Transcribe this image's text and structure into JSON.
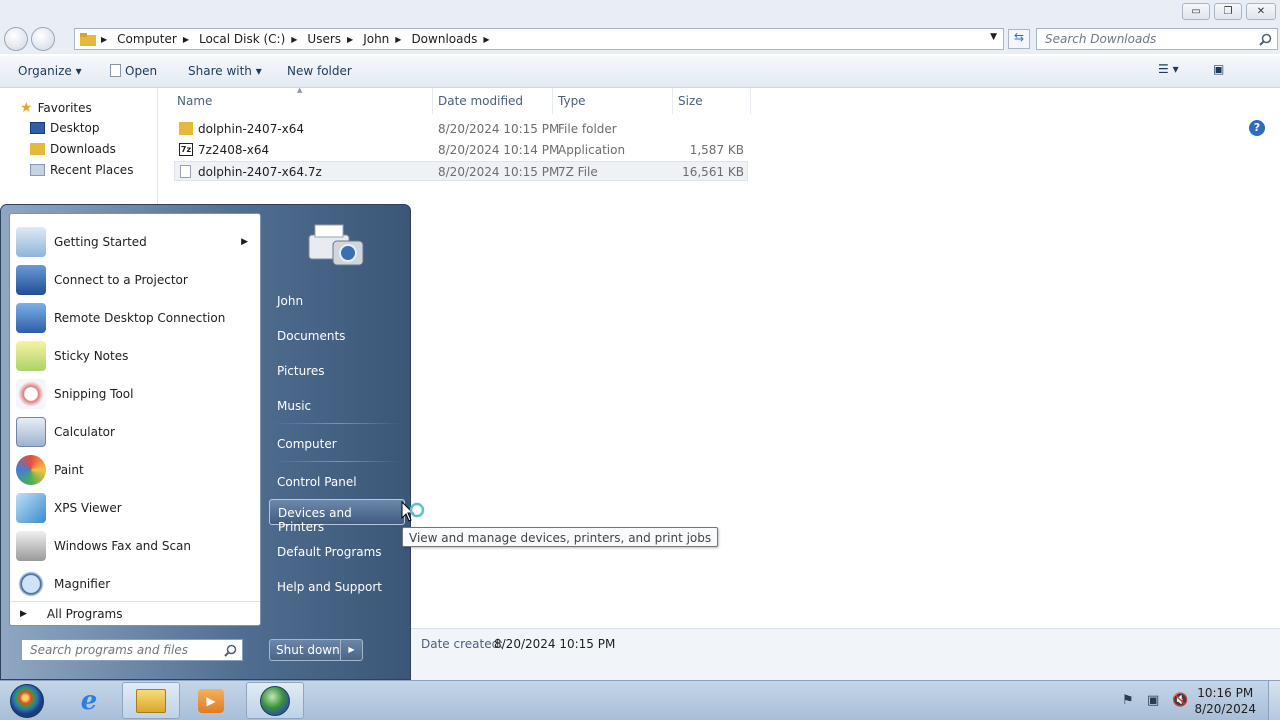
{
  "window": {
    "controls": {
      "minimize": "▭",
      "maximize": "❐",
      "close": "✕"
    }
  },
  "address": {
    "crumbs": [
      "Computer",
      "Local Disk (C:)",
      "Users",
      "John",
      "Downloads"
    ],
    "search_placeholder": "Search Downloads"
  },
  "toolbar": {
    "organize": "Organize",
    "open": "Open",
    "share_with": "Share with",
    "new_folder": "New folder"
  },
  "navpane": {
    "favorites": "Favorites",
    "items": [
      "Desktop",
      "Downloads",
      "Recent Places"
    ]
  },
  "filelist": {
    "columns": [
      "Name",
      "Date modified",
      "Type",
      "Size"
    ],
    "rows": [
      {
        "name": "dolphin-2407-x64",
        "date": "8/20/2024 10:15 PM",
        "type": "File folder",
        "size": ""
      },
      {
        "name": "7z2408-x64",
        "date": "8/20/2024 10:14 PM",
        "type": "Application",
        "size": "1,587 KB"
      },
      {
        "name": "dolphin-2407-x64.7z",
        "date": "8/20/2024 10:15 PM",
        "type": "7Z File",
        "size": "16,561 KB"
      }
    ]
  },
  "details": {
    "label": "Date created:",
    "value": "8/20/2024 10:15 PM"
  },
  "startmenu": {
    "programs": [
      "Getting Started",
      "Connect to a Projector",
      "Remote Desktop Connection",
      "Sticky Notes",
      "Snipping Tool",
      "Calculator",
      "Paint",
      "XPS Viewer",
      "Windows Fax and Scan",
      "Magnifier"
    ],
    "all_programs": "All Programs",
    "search_placeholder": "Search programs and files",
    "right": [
      "John",
      "Documents",
      "Pictures",
      "Music",
      "Computer",
      "Control Panel",
      "Devices and Printers",
      "Default Programs",
      "Help and Support"
    ],
    "shutdown": "Shut down",
    "tooltip": "View and manage devices, printers, and print jobs"
  },
  "taskbar": {
    "time": "10:16 PM",
    "date": "8/20/2024"
  },
  "colors": {
    "accent": "#1e395b",
    "highlight": "#3f5c80",
    "taskbar": "#b6cbe2"
  }
}
